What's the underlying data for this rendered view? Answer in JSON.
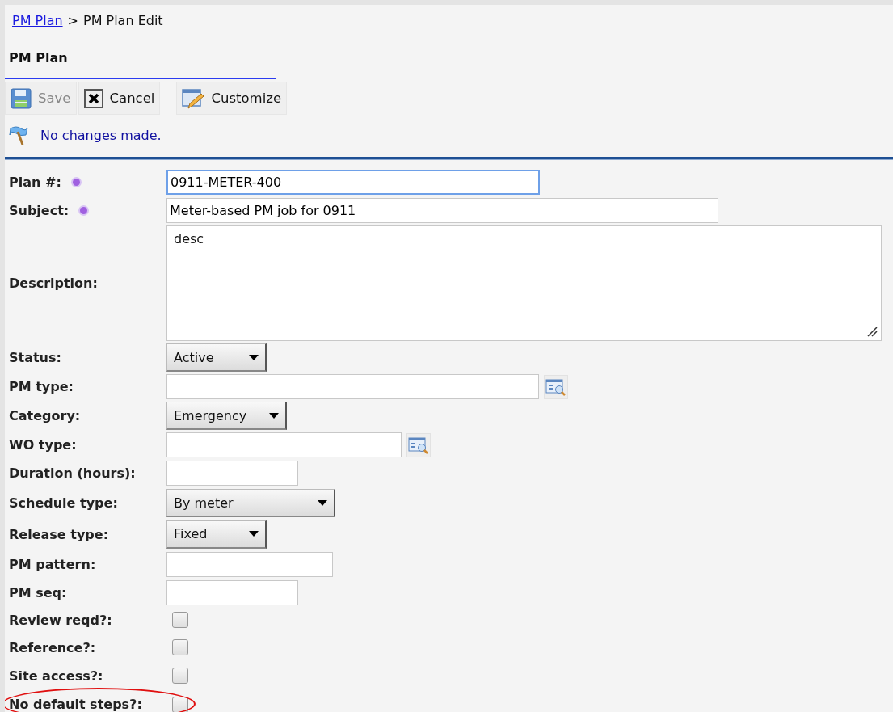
{
  "breadcrumb": {
    "link": "PM Plan",
    "separator": ">",
    "current": "PM Plan Edit"
  },
  "section_title": "PM Plan",
  "toolbar": [
    {
      "kind": "save",
      "label": "Save",
      "disabled": true
    },
    {
      "kind": "cancel",
      "label": "Cancel",
      "disabled": false
    },
    {
      "kind": "customize",
      "label": "Customize",
      "disabled": false
    }
  ],
  "message": "No changes made.",
  "fields": [
    {
      "label": "Plan #:",
      "kind": "text",
      "required": true,
      "focused": true,
      "value": "0911-METER-400",
      "highlighted": false
    },
    {
      "label": "Subject:",
      "kind": "text",
      "required": true,
      "focused": false,
      "value": "Meter-based PM job for 0911",
      "highlighted": false
    },
    {
      "label": "Description:",
      "kind": "textarea",
      "required": false,
      "value": "desc",
      "highlighted": false
    },
    {
      "label": "Status:",
      "kind": "select",
      "required": false,
      "value": "Active",
      "highlighted": false
    },
    {
      "label": "PM type:",
      "kind": "lookup",
      "required": false,
      "focused": false,
      "highlighted": false
    },
    {
      "label": "Category:",
      "kind": "select",
      "required": false,
      "value": "Emergency",
      "highlighted": false
    },
    {
      "label": "WO type:",
      "kind": "lookup",
      "required": false,
      "focused": false,
      "highlighted": false
    },
    {
      "label": "Duration (hours):",
      "kind": "text",
      "required": false,
      "focused": false,
      "highlighted": false
    },
    {
      "label": "Schedule type:",
      "kind": "select",
      "required": false,
      "value": "By meter",
      "highlighted": false
    },
    {
      "label": "Release type:",
      "kind": "select",
      "required": false,
      "value": "Fixed",
      "highlighted": false
    },
    {
      "label": "PM pattern:",
      "kind": "text",
      "required": false,
      "focused": false,
      "highlighted": false
    },
    {
      "label": "PM seq:",
      "kind": "text",
      "required": false,
      "focused": false,
      "highlighted": false
    },
    {
      "label": "Review reqd?:",
      "kind": "checkbox",
      "required": false,
      "checked": false,
      "highlighted": false
    },
    {
      "label": "Reference?:",
      "kind": "checkbox",
      "required": false,
      "checked": false,
      "highlighted": false
    },
    {
      "label": "Site access?:",
      "kind": "checkbox",
      "required": false,
      "checked": false,
      "highlighted": false
    },
    {
      "label": "No default steps?:",
      "kind": "checkbox",
      "required": false,
      "checked": false,
      "highlighted": true
    }
  ]
}
